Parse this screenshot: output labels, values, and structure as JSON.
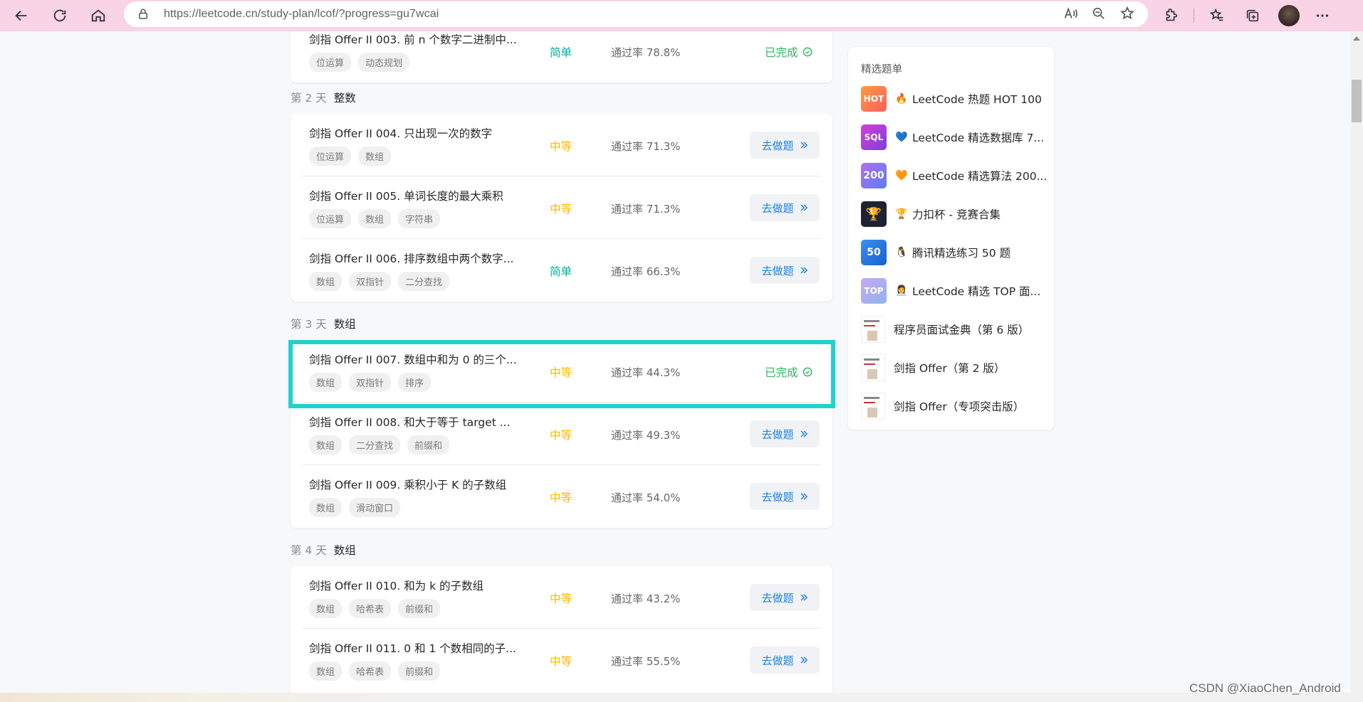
{
  "browser": {
    "url": "https://leetcode.cn/study-plan/lcof/?progress=gu7wcai"
  },
  "labels": {
    "go_button": "去做题",
    "done": "已完成",
    "rate_prefix": "通过率"
  },
  "top_card": {
    "rows": [
      {
        "title": "剑指 Offer II 003. 前 n 个数字二进制中...",
        "tags": [
          "位运算",
          "动态规划"
        ],
        "difficulty": "简单",
        "rate": "通过率 78.8%",
        "status": "done"
      }
    ]
  },
  "days": [
    {
      "day": "第 2 天",
      "topic": "整数",
      "rows": [
        {
          "title": "剑指 Offer II 004. 只出现一次的数字",
          "tags": [
            "位运算",
            "数组"
          ],
          "difficulty": "中等",
          "rate": "通过率 71.3%",
          "status": "todo"
        },
        {
          "title": "剑指 Offer II 005. 单词长度的最大乘积",
          "tags": [
            "位运算",
            "数组",
            "字符串"
          ],
          "difficulty": "中等",
          "rate": "通过率 71.3%",
          "status": "todo"
        },
        {
          "title": "剑指 Offer II 006. 排序数组中两个数字...",
          "tags": [
            "数组",
            "双指针",
            "二分查找"
          ],
          "difficulty": "简单",
          "rate": "通过率 66.3%",
          "status": "todo"
        }
      ]
    },
    {
      "day": "第 3 天",
      "topic": "数组",
      "rows": [
        {
          "title": "剑指 Offer II 007. 数组中和为 0 的三个...",
          "tags": [
            "数组",
            "双指针",
            "排序"
          ],
          "difficulty": "中等",
          "rate": "通过率 44.3%",
          "status": "done"
        },
        {
          "title": "剑指 Offer II 008. 和大于等于 target ...",
          "tags": [
            "数组",
            "二分查找",
            "前缀和"
          ],
          "difficulty": "中等",
          "rate": "通过率 49.3%",
          "status": "todo"
        },
        {
          "title": "剑指 Offer II 009. 乘积小于 K 的子数组",
          "tags": [
            "数组",
            "滑动窗口"
          ],
          "difficulty": "中等",
          "rate": "通过率 54.0%",
          "status": "todo"
        }
      ]
    },
    {
      "day": "第 4 天",
      "topic": "数组",
      "rows": [
        {
          "title": "剑指 Offer II 010. 和为 k 的子数组",
          "tags": [
            "数组",
            "哈希表",
            "前缀和"
          ],
          "difficulty": "中等",
          "rate": "通过率 43.2%",
          "status": "todo"
        },
        {
          "title": "剑指 Offer II 011. 0 和 1 个数相同的子...",
          "tags": [
            "数组",
            "哈希表",
            "前缀和"
          ],
          "difficulty": "中等",
          "rate": "通过率 55.5%",
          "status": "todo"
        }
      ]
    }
  ],
  "sidebar": {
    "title": "精选题单",
    "items": [
      {
        "icon_text": "HOT",
        "icon_color": "#ff7a45",
        "emoji": "🔥",
        "label": "LeetCode 热题 HOT 100"
      },
      {
        "icon_text": "SQL",
        "icon_color": "#c03fd6",
        "emoji": "💙",
        "label": "LeetCode 精选数据库 7..."
      },
      {
        "icon_text": "200",
        "icon_color": "#8a63e8",
        "emoji": "🧡",
        "label": "LeetCode 精选算法 200..."
      },
      {
        "icon_text": "🏆",
        "icon_color": "#1f2233",
        "emoji": "🏆",
        "label": "力扣杯 - 竞赛合集"
      },
      {
        "icon_text": "50",
        "icon_color": "#2f7fe8",
        "emoji": "🐧",
        "label": "腾讯精选练习 50 题"
      },
      {
        "icon_text": "TOP",
        "icon_color": "#9f8fe8",
        "emoji": "👩‍💼",
        "label": "LeetCode 精选 TOP 面..."
      },
      {
        "icon_text": "",
        "icon_color": "#ffffff",
        "emoji": "",
        "label": "程序员面试金典（第 6 版）"
      },
      {
        "icon_text": "",
        "icon_color": "#ffffff",
        "emoji": "",
        "label": "剑指 Offer（第 2 版）"
      },
      {
        "icon_text": "",
        "icon_color": "#ffffff",
        "emoji": "",
        "label": "剑指 Offer（专项突击版）"
      }
    ]
  },
  "watermark": "CSDN @XiaoChen_Android",
  "colors": {
    "medium": "#ffb800",
    "easy": "#00af9b",
    "done": "#2db55d",
    "link": "#1e83e6",
    "highlight": "#1ed3cf"
  }
}
